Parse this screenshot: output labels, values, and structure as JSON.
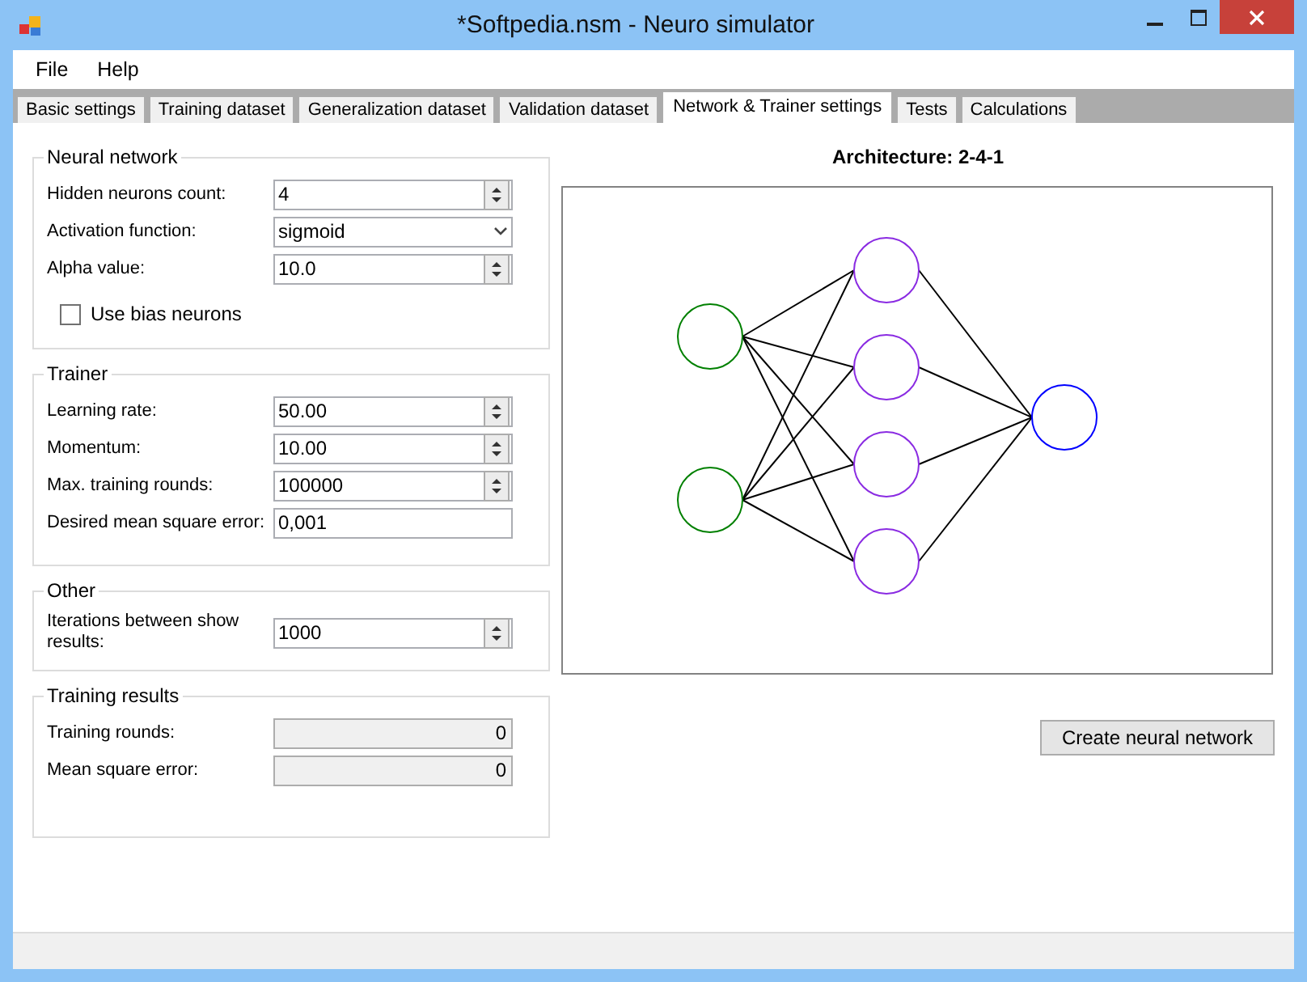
{
  "window": {
    "title": "*Softpedia.nsm - Neuro simulator"
  },
  "menu": [
    "File",
    "Help"
  ],
  "tabs": [
    {
      "label": "Basic settings",
      "selected": false
    },
    {
      "label": "Training dataset",
      "selected": false
    },
    {
      "label": "Generalization dataset",
      "selected": false
    },
    {
      "label": "Validation dataset",
      "selected": false
    },
    {
      "label": "Network & Trainer settings",
      "selected": true
    },
    {
      "label": "Tests",
      "selected": false
    },
    {
      "label": "Calculations",
      "selected": false
    }
  ],
  "groups": [
    {
      "title": "Neural network",
      "fields": [
        {
          "kind": "spin",
          "label": "Hidden neurons count:",
          "value": "4"
        },
        {
          "kind": "combo",
          "label": "Activation function:",
          "value": "sigmoid"
        },
        {
          "kind": "spin",
          "label": "Alpha value:",
          "value": "10.0"
        },
        {
          "kind": "checkbox",
          "label": "Use bias neurons",
          "checked": false
        }
      ]
    },
    {
      "title": "Trainer",
      "fields": [
        {
          "kind": "spin",
          "label": "Learning rate:",
          "value": "50.00"
        },
        {
          "kind": "spin",
          "label": "Momentum:",
          "value": "10.00"
        },
        {
          "kind": "spin",
          "label": "Max. training rounds:",
          "value": "100000"
        },
        {
          "kind": "text",
          "label": "Desired mean square error:",
          "value": "0,001"
        }
      ]
    },
    {
      "title": "Other",
      "fields": [
        {
          "kind": "spin",
          "label": "Iterations between show results:",
          "value": "1000"
        }
      ]
    },
    {
      "title": "Training results",
      "fields": [
        {
          "kind": "readonly",
          "label": "Training rounds:",
          "value": "0"
        },
        {
          "kind": "readonly",
          "label": "Mean square error:",
          "value": "0"
        }
      ]
    }
  ],
  "architecture": {
    "title": "Architecture: 2-4-1"
  },
  "create_button": "Create neural network"
}
